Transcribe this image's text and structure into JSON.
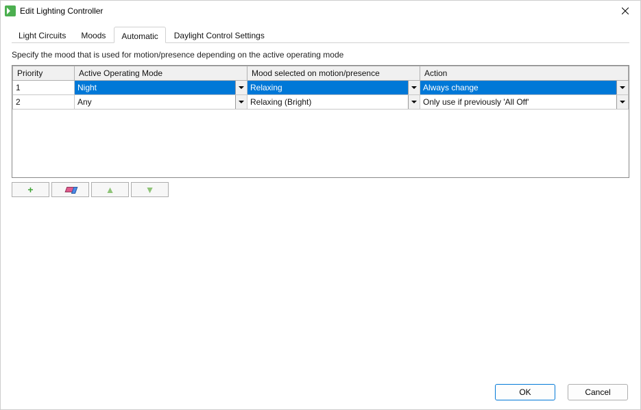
{
  "title": "Edit Lighting Controller",
  "tabs": [
    {
      "label": "Light Circuits",
      "active": false
    },
    {
      "label": "Moods",
      "active": false
    },
    {
      "label": "Automatic",
      "active": true
    },
    {
      "label": "Daylight Control Settings",
      "active": false
    }
  ],
  "description": "Specify the mood that is used for motion/presence depending on the active operating mode",
  "columns": {
    "priority": "Priority",
    "mode": "Active Operating Mode",
    "mood": "Mood selected on motion/presence",
    "action": "Action"
  },
  "rows": [
    {
      "priority": "1",
      "mode": "Night",
      "mood": "Relaxing",
      "action": "Always change",
      "selected": true
    },
    {
      "priority": "2",
      "mode": "Any",
      "mood": "Relaxing (Bright)",
      "action": "Only use if previously 'All Off'",
      "selected": false
    }
  ],
  "toolbar": {
    "add": "add",
    "delete": "delete",
    "up": "move up",
    "down": "move down"
  },
  "buttons": {
    "ok": "OK",
    "cancel": "Cancel"
  }
}
